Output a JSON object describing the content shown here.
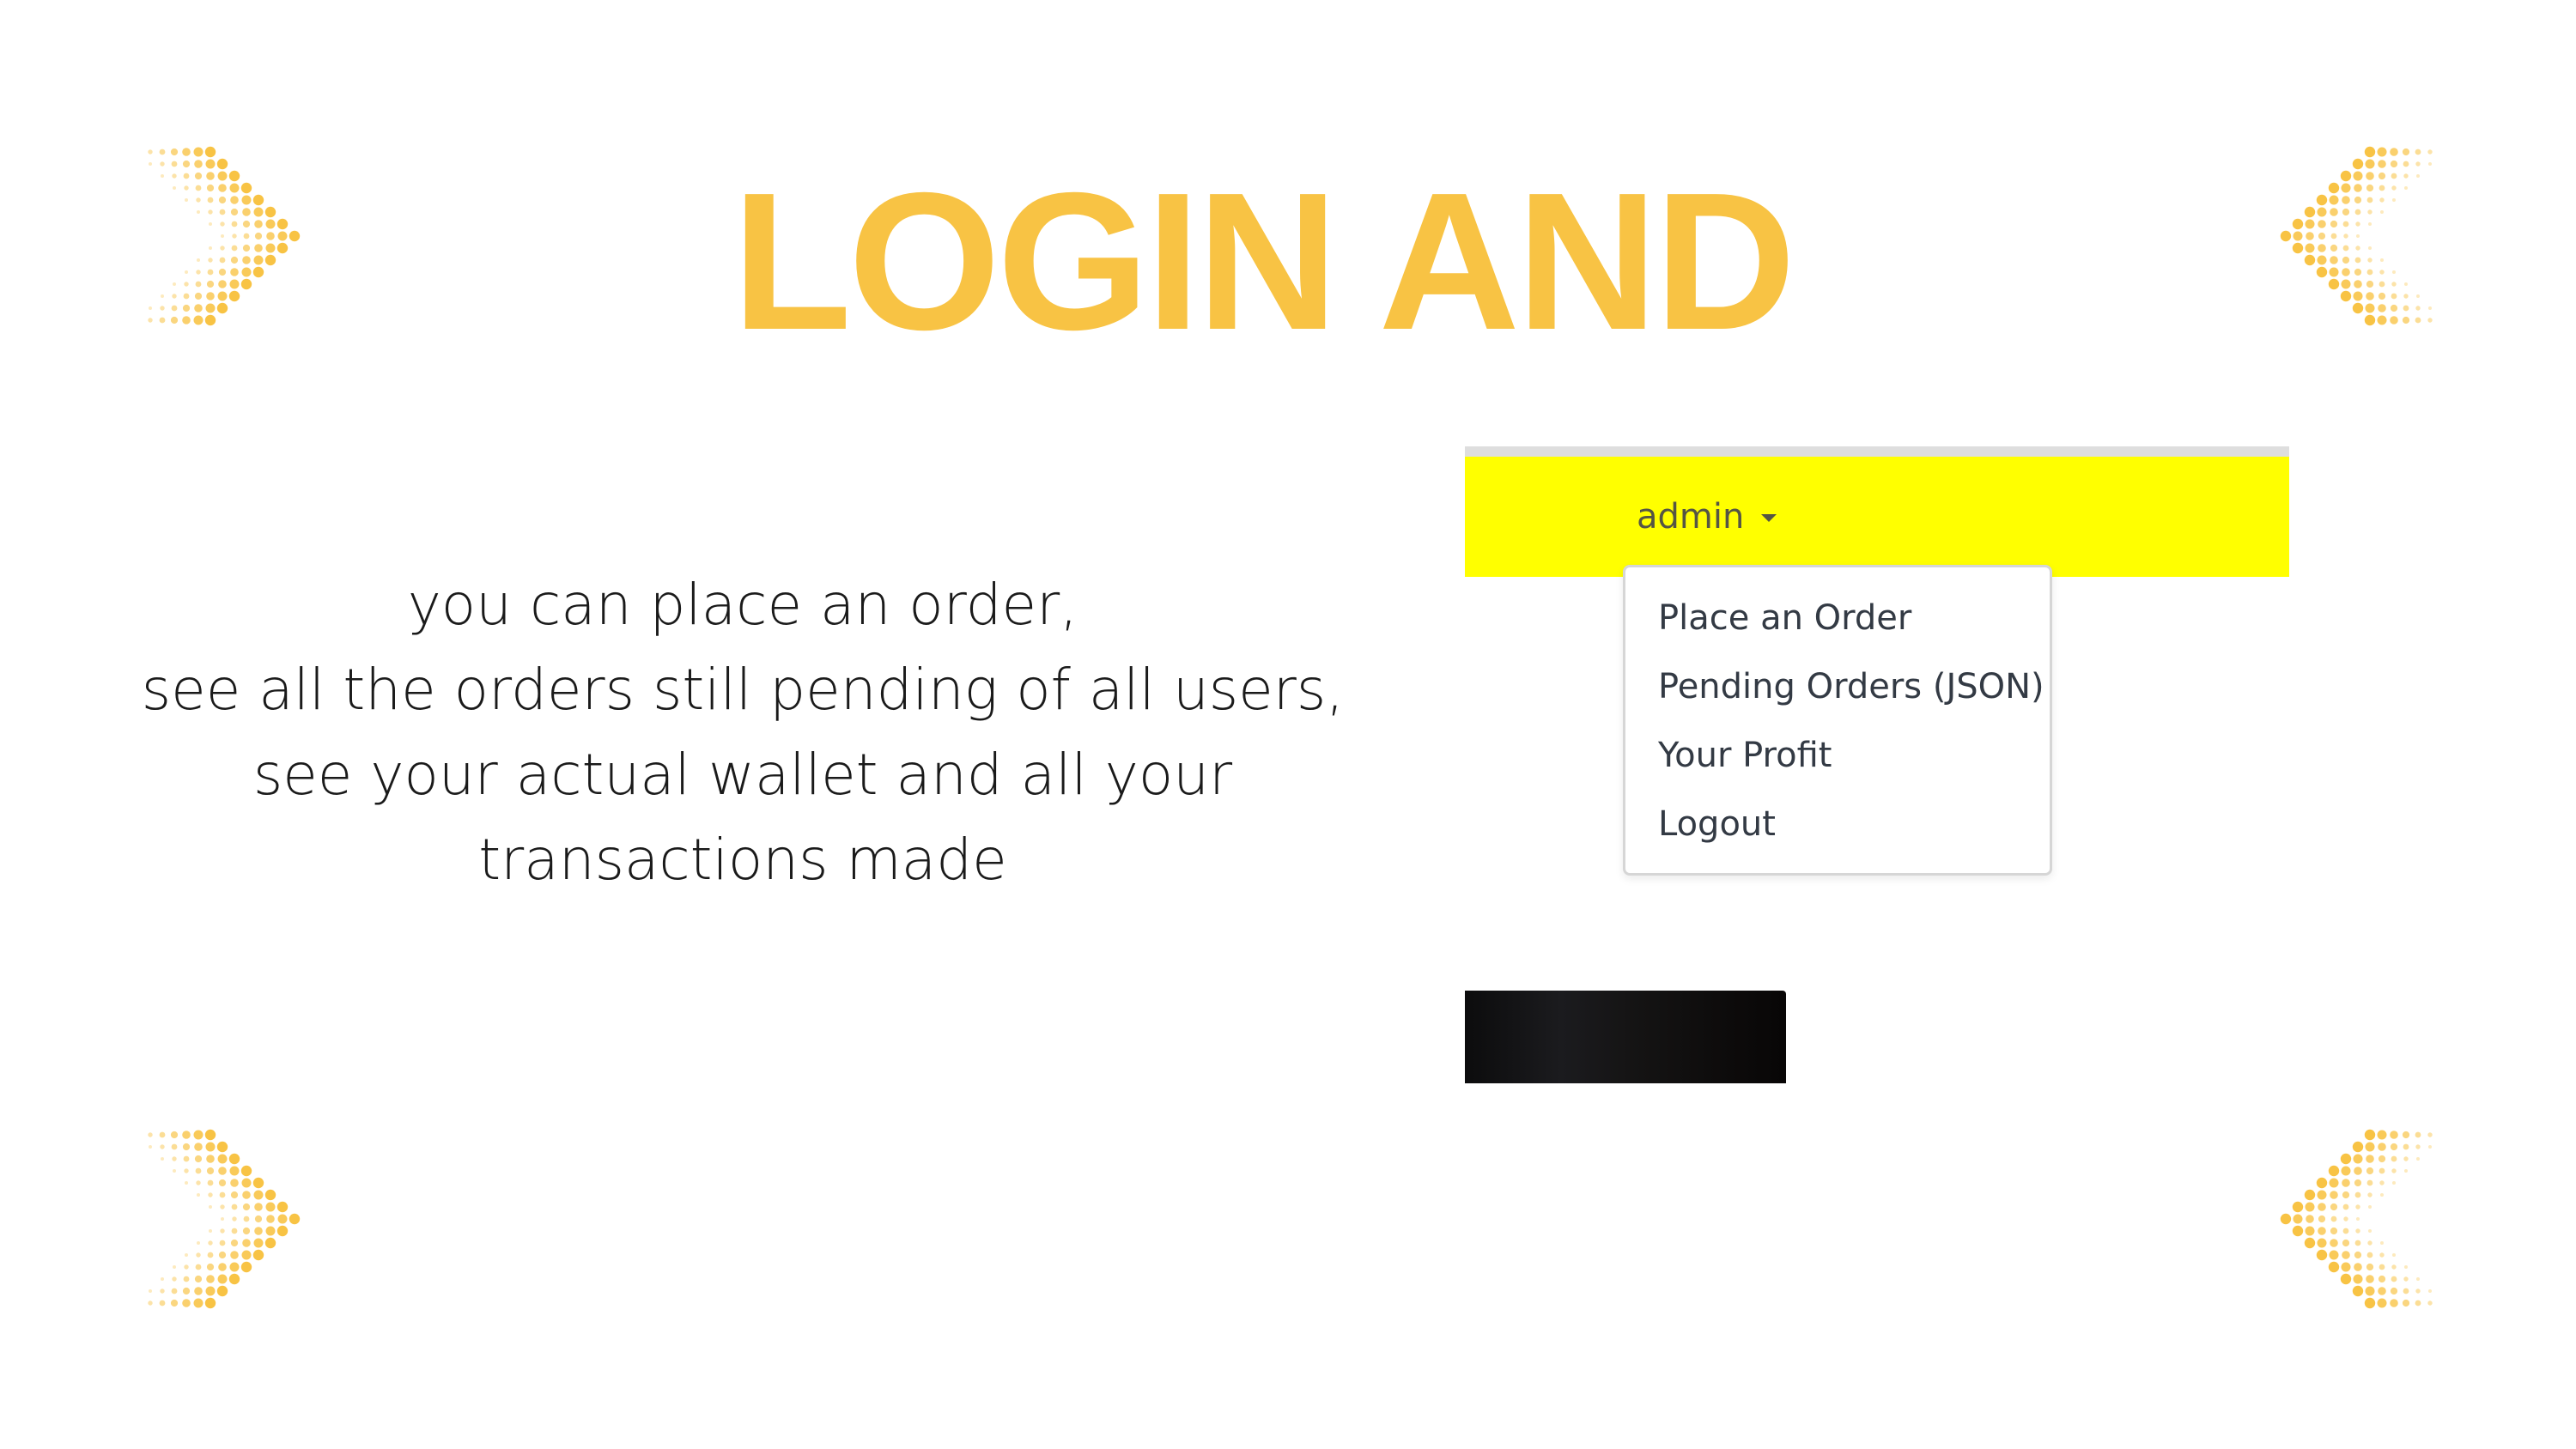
{
  "headline": "LOGIN AND",
  "description_lines": [
    "you can place an order,",
    "see all the orders still pending of all users,",
    "see your actual wallet and all your",
    "transactions made"
  ],
  "screenshot": {
    "navbar_color": "#ffff00",
    "user_menu_label": "admin",
    "menu_items": [
      "Place an Order",
      "Pending Orders (JSON)",
      "Your Profit",
      "Logout"
    ]
  },
  "colors": {
    "accent": "#f8c344",
    "text": "#1a1a1a",
    "navbar": "#ffff00"
  },
  "icons": [
    "chevron-right-icon",
    "chevron-left-icon",
    "caret-down-icon"
  ]
}
